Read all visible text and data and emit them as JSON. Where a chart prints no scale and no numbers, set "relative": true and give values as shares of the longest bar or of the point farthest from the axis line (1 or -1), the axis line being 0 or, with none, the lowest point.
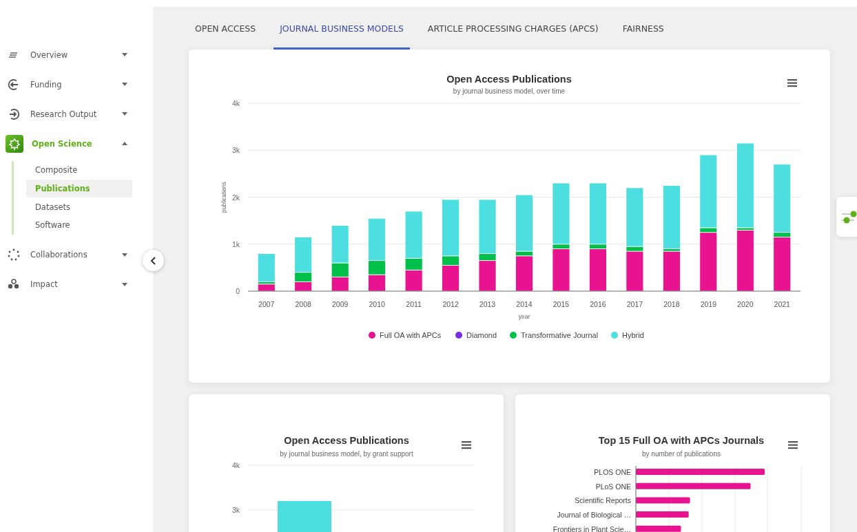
{
  "sidebar": {
    "items": [
      {
        "label": "Overview",
        "expanded": false,
        "selected": false
      },
      {
        "label": "Funding",
        "expanded": false,
        "selected": false
      },
      {
        "label": "Research Output",
        "expanded": false,
        "selected": false
      },
      {
        "label": "Open Science",
        "expanded": true,
        "selected": true,
        "children": [
          {
            "label": "Composite",
            "selected": false
          },
          {
            "label": "Publications",
            "selected": true
          },
          {
            "label": "Datasets",
            "selected": false
          },
          {
            "label": "Software",
            "selected": false
          }
        ]
      },
      {
        "label": "Collaborations",
        "expanded": false,
        "selected": false
      },
      {
        "label": "Impact",
        "expanded": false,
        "selected": false
      }
    ]
  },
  "tabs": [
    {
      "label": "OPEN ACCESS",
      "selected": false
    },
    {
      "label": "JOURNAL BUSINESS MODELS",
      "selected": true
    },
    {
      "label": "ARTICLE PROCESSING CHARGES (APCS)",
      "selected": false
    },
    {
      "label": "FAIRNESS",
      "selected": false
    }
  ],
  "charts": [
    {
      "chart_data": {
        "type": "bar",
        "title": "Open Access Publications",
        "subtitle": "by journal business model, over time",
        "xlabel": "year",
        "ylabel": "publications",
        "stacked": true,
        "grid": true,
        "legend": true,
        "categories": [
          "2007",
          "2008",
          "2009",
          "2010",
          "2011",
          "2012",
          "2013",
          "2014",
          "2015",
          "2016",
          "2017",
          "2018",
          "2019",
          "2020",
          "2021"
        ],
        "ylim": [
          0,
          4000
        ],
        "yticks": [
          {
            "value": 0,
            "label": "0"
          },
          {
            "value": 1000,
            "label": "1k"
          },
          {
            "value": 2000,
            "label": "2k"
          },
          {
            "value": 3000,
            "label": "3k"
          },
          {
            "value": 4000,
            "label": "4k"
          }
        ],
        "series": [
          {
            "name": "Full OA with APCs",
            "color": "#e8138f",
            "values": [
              150,
              200,
              300,
              350,
              450,
              550,
              650,
              750,
              900,
              900,
              850,
              850,
              1250,
              1300,
              1150
            ]
          },
          {
            "name": "Diamond",
            "color": "#7b2de0",
            "values": [
              0,
              0,
              0,
              0,
              0,
              0,
              0,
              0,
              0,
              0,
              0,
              0,
              0,
              0,
              0
            ]
          },
          {
            "name": "Transformative Journal",
            "color": "#00c04a",
            "values": [
              50,
              200,
              300,
              300,
              250,
              200,
              150,
              100,
              100,
              100,
              100,
              50,
              100,
              50,
              100
            ]
          },
          {
            "name": "Hybrid",
            "color": "#4ddfdf",
            "values": [
              600,
              750,
              800,
              900,
              1000,
              1200,
              1150,
              1200,
              1300,
              1300,
              1250,
              1350,
              1550,
              1800,
              1450
            ]
          }
        ]
      }
    },
    {
      "chart_data": {
        "type": "bar",
        "title": "Open Access Publications",
        "subtitle": "by journal business model, by grant support",
        "ylim": [
          0,
          4000
        ],
        "grid": true,
        "yticks": [
          {
            "value": 3000,
            "label": "3k"
          },
          {
            "value": 4000,
            "label": "4k"
          }
        ],
        "series": [
          {
            "color": "#4ddfdf",
            "values": [
              3200
            ]
          }
        ]
      }
    },
    {
      "chart_data": {
        "type": "bar",
        "orientation": "horizontal",
        "relative": true,
        "grid": true,
        "title": "Top 15 Full OA with APCs Journals",
        "subtitle": "by number of publications",
        "categories": [
          "PLOS ONE",
          "PLoS ONE",
          "Scientific Reports",
          "Journal of Biological …",
          "Frontiers in Plant Scie…"
        ],
        "series": [
          {
            "color": "#e8138f",
            "values": [
              1,
              0.89,
              0.42,
              0.41,
              0.35
            ]
          }
        ]
      }
    }
  ]
}
